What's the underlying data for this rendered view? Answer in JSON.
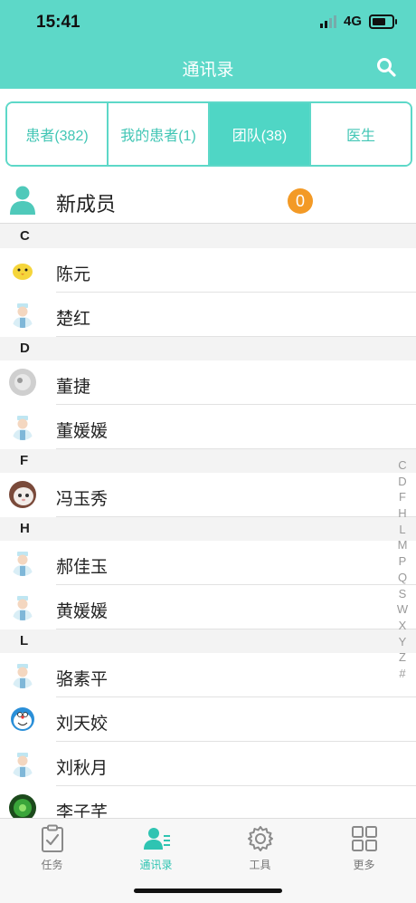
{
  "status_bar": {
    "time": "15:41",
    "network": "4G"
  },
  "navbar": {
    "title": "通讯录"
  },
  "tabs": [
    {
      "label": "患者(382)",
      "active": false
    },
    {
      "label": "我的患者(1)",
      "active": false
    },
    {
      "label": "团队(38)",
      "active": true
    },
    {
      "label": "医生",
      "active": false
    }
  ],
  "new_members": {
    "label": "新成员",
    "count": "0"
  },
  "sections": [
    {
      "letter": "C",
      "contacts": [
        {
          "name": "陈元",
          "avatar": "chick-avatar"
        },
        {
          "name": "楚红",
          "avatar": "nurse-avatar"
        }
      ]
    },
    {
      "letter": "D",
      "contacts": [
        {
          "name": "董捷",
          "avatar": "gray-photo-avatar"
        },
        {
          "name": "董媛媛",
          "avatar": "nurse-avatar"
        }
      ]
    },
    {
      "letter": "F",
      "contacts": [
        {
          "name": "冯玉秀",
          "avatar": "cat-photo-avatar"
        }
      ]
    },
    {
      "letter": "H",
      "contacts": [
        {
          "name": "郝佳玉",
          "avatar": "nurse-avatar"
        },
        {
          "name": "黄媛媛",
          "avatar": "nurse-avatar"
        }
      ]
    },
    {
      "letter": "L",
      "contacts": [
        {
          "name": "骆素平",
          "avatar": "nurse-avatar"
        },
        {
          "name": "刘天姣",
          "avatar": "doraemon-avatar"
        },
        {
          "name": "刘秋月",
          "avatar": "nurse-avatar"
        },
        {
          "name": "李子芊",
          "avatar": "green-photo-avatar"
        }
      ]
    }
  ],
  "index_letters": [
    "C",
    "D",
    "F",
    "H",
    "L",
    "M",
    "P",
    "Q",
    "S",
    "W",
    "X",
    "Y",
    "Z",
    "#"
  ],
  "tabbar": [
    {
      "label": "任务",
      "icon": "clipboard-check-icon",
      "active": false
    },
    {
      "label": "通讯录",
      "icon": "contacts-icon",
      "active": true
    },
    {
      "label": "工具",
      "icon": "gear-icon",
      "active": false
    },
    {
      "label": "更多",
      "icon": "grid-icon",
      "active": false
    }
  ],
  "colors": {
    "accent": "#5dd8c8",
    "badge": "#f39a26"
  }
}
